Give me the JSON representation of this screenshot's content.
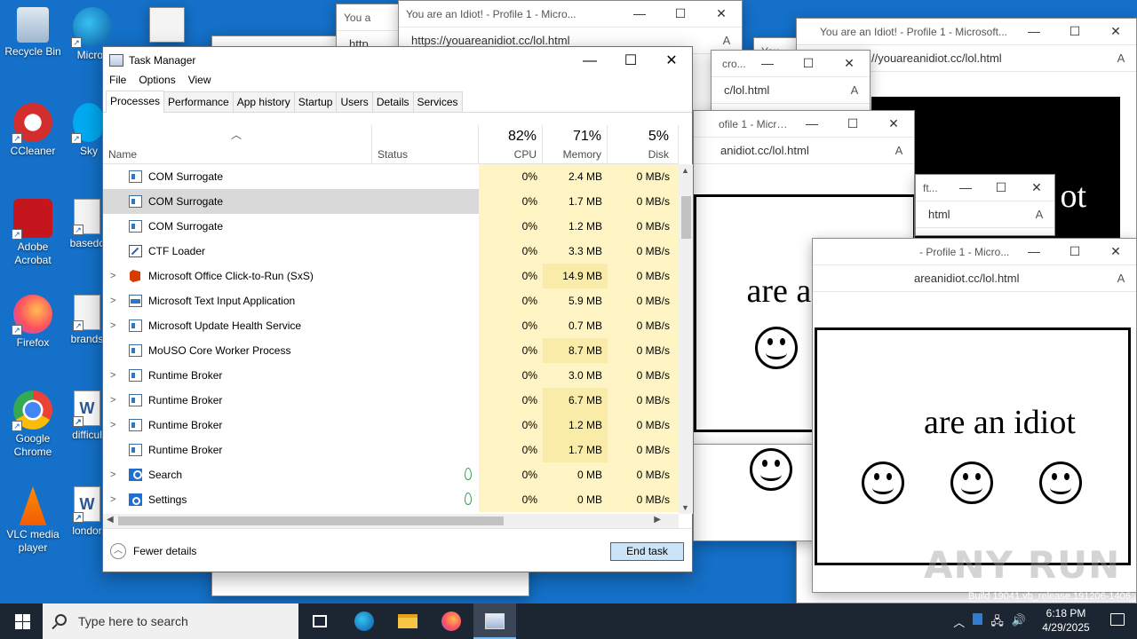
{
  "desktop": {
    "icons": [
      {
        "label": "Recycle Bin"
      },
      {
        "label": "Micro Ed"
      },
      {
        "label": "CCleaner"
      },
      {
        "label": "Sky"
      },
      {
        "label": "Adobe Acrobat"
      },
      {
        "label": "basedc"
      },
      {
        "label": "Firefox"
      },
      {
        "label": "brands"
      },
      {
        "label": "Google Chrome"
      },
      {
        "label": "difficul"
      },
      {
        "label": "VLC media player"
      },
      {
        "label": "londor"
      }
    ]
  },
  "browser_windows": [
    {
      "title": "You are an Idiot! - Profile 1 - Micro...",
      "url": "https://youareanidiot.cc/lol.html"
    },
    {
      "title": "You are an Idiot! - Profile 1 - Microsoft...",
      "url": "//youareanidiot.cc/lol.html"
    },
    {
      "title": "cro...",
      "url": "c/lol.html"
    },
    {
      "title": "ofile 1 - Micro...",
      "url": "anidiot.cc/lol.html"
    },
    {
      "title": "ft...",
      "url": "html"
    },
    {
      "title": "- Profile 1 - Micro...",
      "url": "areanidiot.cc/lol.html"
    },
    {
      "title": "You a",
      "url": "http"
    },
    {
      "title": "You"
    }
  ],
  "idiot_text": {
    "a": "are an idiot",
    "b": "are an idiot",
    "c": "ot"
  },
  "task_manager": {
    "title": "Task Manager",
    "menu": [
      "File",
      "Options",
      "View"
    ],
    "tabs": [
      "Processes",
      "Performance",
      "App history",
      "Startup",
      "Users",
      "Details",
      "Services"
    ],
    "active_tab": "Processes",
    "columns": {
      "name": "Name",
      "status": "Status",
      "cpu": {
        "pct": "82%",
        "label": "CPU"
      },
      "memory": {
        "pct": "71%",
        "label": "Memory"
      },
      "disk": {
        "pct": "5%",
        "label": "Disk"
      }
    },
    "rows": [
      {
        "name": "COM Surrogate",
        "cpu": "0%",
        "mem": "2.4 MB",
        "disk": "0 MB/s"
      },
      {
        "name": "COM Surrogate",
        "cpu": "0%",
        "mem": "1.7 MB",
        "disk": "0 MB/s"
      },
      {
        "name": "COM Surrogate",
        "cpu": "0%",
        "mem": "1.2 MB",
        "disk": "0 MB/s"
      },
      {
        "name": "CTF Loader",
        "cpu": "0%",
        "mem": "3.3 MB",
        "disk": "0 MB/s"
      },
      {
        "name": "Microsoft Office Click-to-Run (SxS)",
        "cpu": "0%",
        "mem": "14.9 MB",
        "disk": "0 MB/s"
      },
      {
        "name": "Microsoft Text Input Application",
        "cpu": "0%",
        "mem": "5.9 MB",
        "disk": "0 MB/s"
      },
      {
        "name": "Microsoft Update Health Service",
        "cpu": "0%",
        "mem": "0.7 MB",
        "disk": "0 MB/s"
      },
      {
        "name": "MoUSO Core Worker Process",
        "cpu": "0%",
        "mem": "8.7 MB",
        "disk": "0 MB/s"
      },
      {
        "name": "Runtime Broker",
        "cpu": "0%",
        "mem": "3.0 MB",
        "disk": "0 MB/s"
      },
      {
        "name": "Runtime Broker",
        "cpu": "0%",
        "mem": "6.7 MB",
        "disk": "0 MB/s"
      },
      {
        "name": "Runtime Broker",
        "cpu": "0%",
        "mem": "1.2 MB",
        "disk": "0 MB/s"
      },
      {
        "name": "Runtime Broker",
        "cpu": "0%",
        "mem": "1.7 MB",
        "disk": "0 MB/s"
      },
      {
        "name": "Search",
        "cpu": "0%",
        "mem": "0 MB",
        "disk": "0 MB/s"
      },
      {
        "name": "Settings",
        "cpu": "0%",
        "mem": "0 MB",
        "disk": "0 MB/s"
      }
    ],
    "fewer_details": "Fewer details",
    "end_task": "End task"
  },
  "taskbar": {
    "search_placeholder": "Type here to search",
    "time": "6:18 PM",
    "date": "4/29/2025"
  },
  "watermark": "ANY RUN",
  "build_text": "Build 19041.vb_release.191206-1406"
}
